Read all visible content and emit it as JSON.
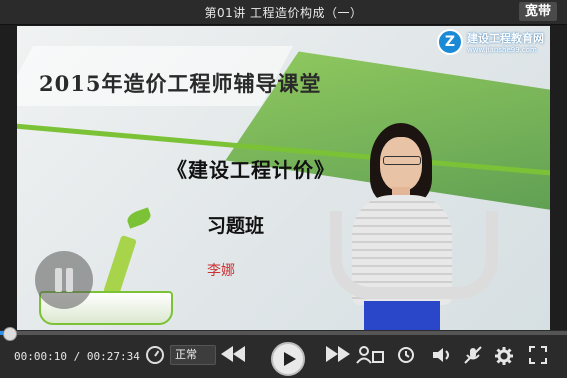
{
  "titlebar": {
    "title": "第01讲   工程造价构成（一）",
    "badge": "宽带"
  },
  "slide": {
    "logo_name": "建设工程教育网",
    "logo_url": "www.jianshe99.com",
    "headline": "2015年造价工程师辅导课堂",
    "course_title": "《建设工程计价》",
    "class_type": "习题班",
    "teacher": "李娜"
  },
  "player": {
    "current_time": "00:00:10",
    "time_separator": "/",
    "total_time": "00:27:34",
    "speed_label": "正常",
    "progress_fraction": 0.006
  },
  "icons": [
    "pause-icon",
    "speed-icon",
    "rewind-icon",
    "play-icon",
    "fast-forward-icon",
    "person-icon",
    "clock-icon",
    "volume-icon",
    "no-mic-icon",
    "settings-icon",
    "fullscreen-icon"
  ],
  "colors": {
    "accent": "#2f8fe5",
    "slide_green": "#7bc236",
    "teacher_red": "#cc3333"
  }
}
